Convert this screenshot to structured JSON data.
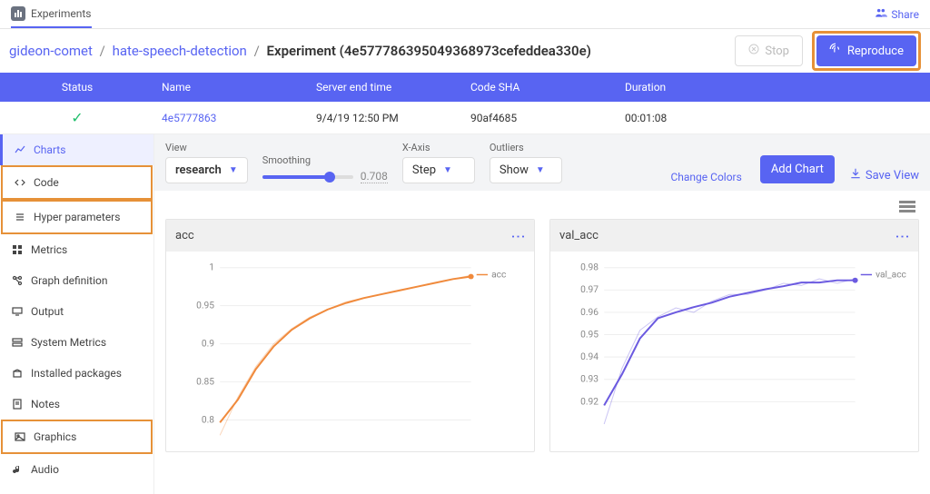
{
  "topbar": {
    "tab": "Experiments",
    "share": "Share"
  },
  "breadcrumb": {
    "user": "gideon-comet",
    "project": "hate-speech-detection",
    "experiment_label": "Experiment",
    "experiment_id": "(4e577786395049368973cefeddea330e)"
  },
  "actions": {
    "stop": "Stop",
    "reproduce": "Reproduce"
  },
  "table": {
    "headers": {
      "status": "Status",
      "name": "Name",
      "time": "Server end time",
      "sha": "Code SHA",
      "dur": "Duration"
    },
    "row": {
      "status_glyph": "✓",
      "name": "4e5777863",
      "time": "9/4/19 12:50 PM",
      "sha": "90af4685",
      "dur": "00:01:08"
    }
  },
  "sidebar": {
    "charts": "Charts",
    "code": "Code",
    "hyper": "Hyper parameters",
    "metrics": "Metrics",
    "graph": "Graph definition",
    "output": "Output",
    "system": "System Metrics",
    "packages": "Installed packages",
    "notes": "Notes",
    "graphics": "Graphics",
    "audio": "Audio"
  },
  "controls": {
    "view_label": "View",
    "view_value": "research",
    "smoothing_label": "Smoothing",
    "smoothing_value": "0.708",
    "xaxis_label": "X-Axis",
    "xaxis_value": "Step",
    "outliers_label": "Outliers",
    "outliers_value": "Show",
    "change_colors": "Change Colors",
    "add_chart": "Add Chart",
    "save_view": "Save View"
  },
  "chart_data": [
    {
      "type": "line",
      "title": "acc",
      "series": [
        {
          "name": "acc",
          "color": "#f08a3c",
          "x": [
            0,
            1,
            2,
            3,
            4,
            5,
            6,
            7,
            8,
            9,
            10,
            11,
            12,
            13,
            14
          ],
          "values": [
            0.78,
            0.83,
            0.87,
            0.9,
            0.92,
            0.935,
            0.945,
            0.955,
            0.96,
            0.965,
            0.97,
            0.975,
            0.98,
            0.985,
            0.99
          ]
        }
      ],
      "yticks": [
        0.8,
        0.85,
        0.9,
        0.95,
        1.0
      ],
      "ylim": [
        0.78,
        1.0
      ]
    },
    {
      "type": "line",
      "title": "val_acc",
      "series": [
        {
          "name": "val_acc",
          "color": "#6b5ae0",
          "x": [
            0,
            1,
            2,
            3,
            4,
            5,
            6,
            7,
            8,
            9,
            10,
            11,
            12,
            13,
            14
          ],
          "values": [
            0.91,
            0.935,
            0.952,
            0.958,
            0.962,
            0.96,
            0.965,
            0.968,
            0.968,
            0.97,
            0.973,
            0.972,
            0.975,
            0.973,
            0.975
          ]
        }
      ],
      "yticks": [
        0.92,
        0.93,
        0.94,
        0.95,
        0.96,
        0.97,
        0.98
      ],
      "ylim": [
        0.905,
        0.98
      ]
    }
  ]
}
